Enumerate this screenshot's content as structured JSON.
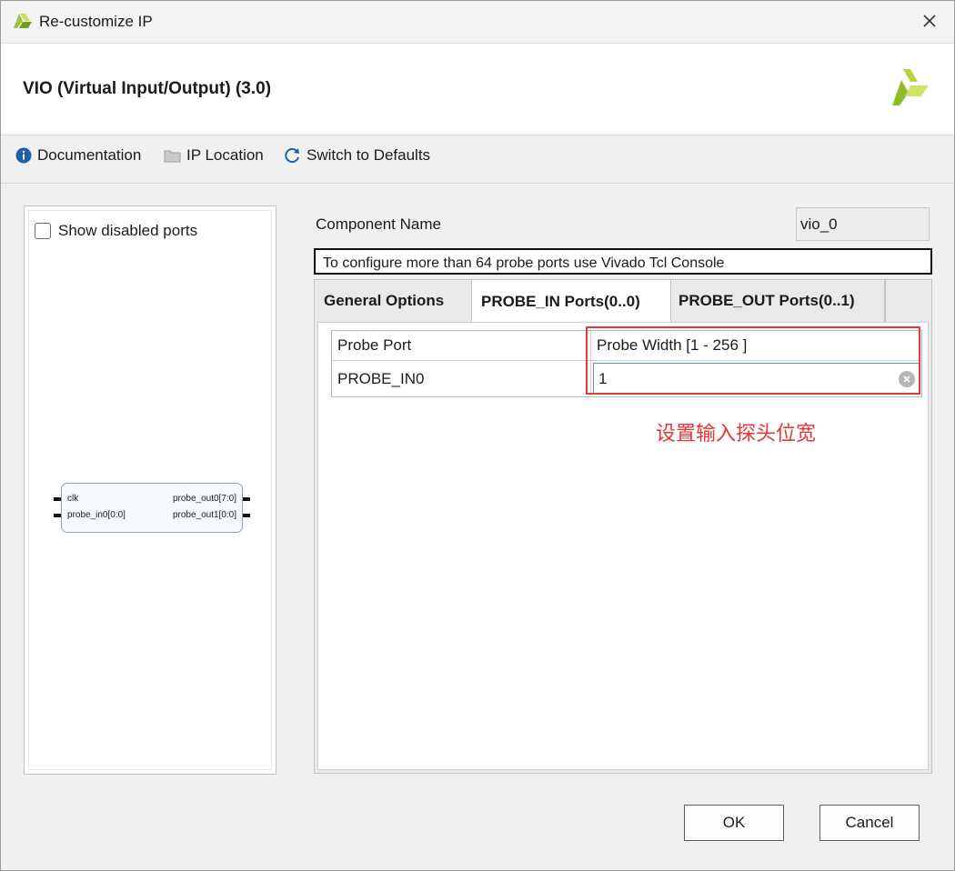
{
  "window": {
    "title": "Re-customize IP",
    "close_icon": "close-icon"
  },
  "header": {
    "ip_title": "VIO (Virtual Input/Output) (3.0)",
    "brand_icon": "xilinx-logo-icon"
  },
  "toolbar": {
    "documentation": "Documentation",
    "ip_location": "IP Location",
    "switch_defaults": "Switch to Defaults"
  },
  "left_panel": {
    "show_disabled_label": "Show disabled ports",
    "show_disabled_checked": false,
    "symbol": {
      "left_ports": [
        "clk",
        "probe_in0[0:0]"
      ],
      "right_ports": [
        "probe_out0[7:0]",
        "probe_out1[0:0]"
      ]
    }
  },
  "component": {
    "label": "Component Name",
    "value": "vio_0"
  },
  "note": "To configure more than 64 probe ports use Vivado Tcl Console",
  "tabs": [
    {
      "label": "General Options",
      "active": false
    },
    {
      "label": "PROBE_IN Ports(0..0)",
      "active": true
    },
    {
      "label": "PROBE_OUT Ports(0..1)",
      "active": false
    }
  ],
  "probe_table": {
    "headers": [
      "Probe Port",
      "Probe Width [1 - 256 ]"
    ],
    "rows": [
      {
        "port": "PROBE_IN0",
        "width": "1"
      }
    ]
  },
  "annotation": "设置输入探头位宽",
  "buttons": {
    "ok": "OK",
    "cancel": "Cancel"
  },
  "colors": {
    "highlight": "#e33b3b",
    "xilinx_green": "#8ebe2a",
    "info_blue": "#1f5fa8"
  }
}
